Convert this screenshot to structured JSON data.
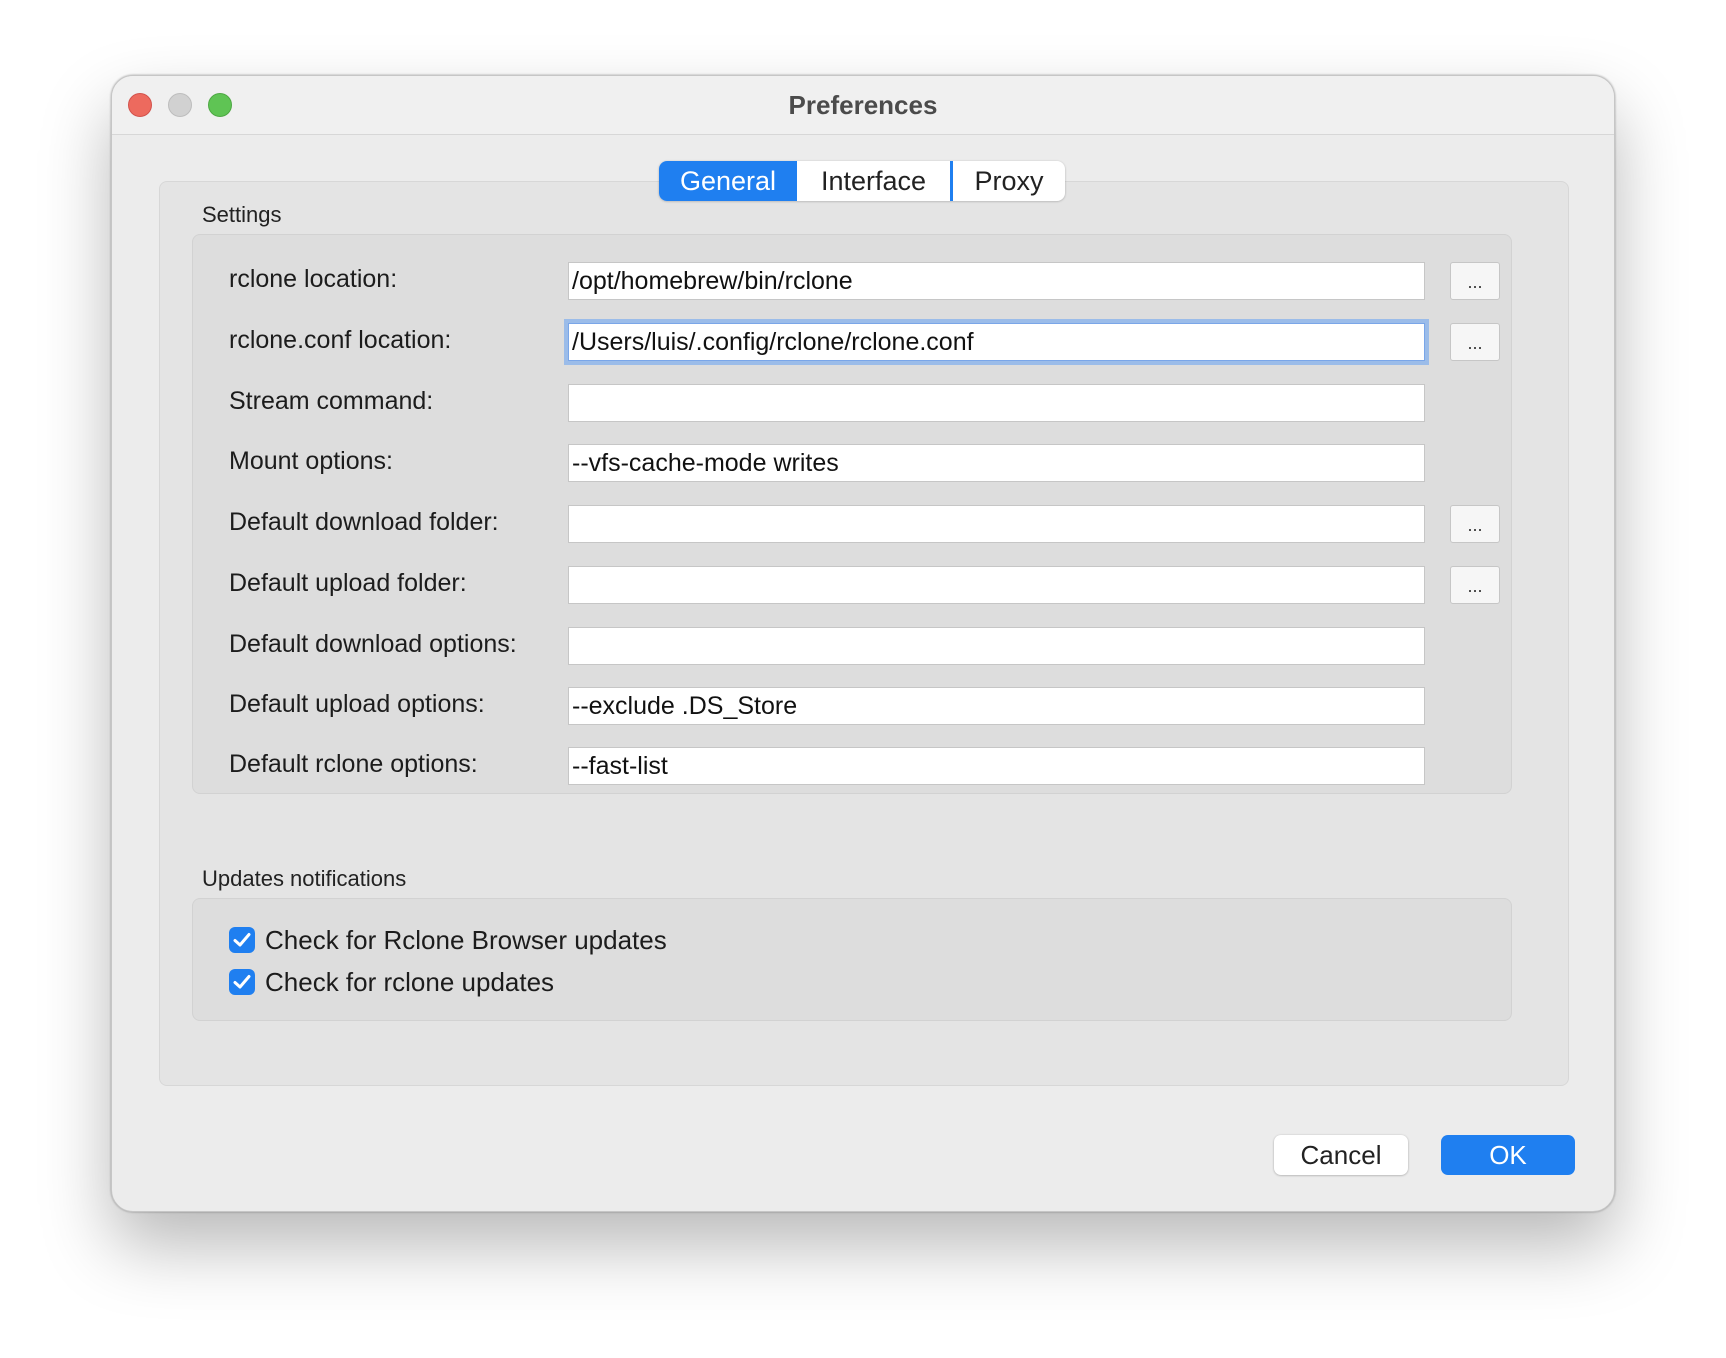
{
  "window": {
    "title": "Preferences"
  },
  "tabs": [
    {
      "label": "General",
      "active": true
    },
    {
      "label": "Interface",
      "active": false
    },
    {
      "label": "Proxy",
      "active": false
    }
  ],
  "settings": {
    "group_label": "Settings",
    "rows": [
      {
        "label": "rclone location:",
        "value": "/opt/homebrew/bin/rclone",
        "has_browse": true
      },
      {
        "label": "rclone.conf location:",
        "value": "/Users/luis/.config/rclone/rclone.conf",
        "has_browse": true,
        "focused": true
      },
      {
        "label": "Stream command:",
        "value": "",
        "has_browse": false
      },
      {
        "label": "Mount options:",
        "value": "--vfs-cache-mode writes",
        "has_browse": false
      },
      {
        "label": "Default download folder:",
        "value": "",
        "has_browse": true
      },
      {
        "label": "Default upload folder:",
        "value": "",
        "has_browse": true
      },
      {
        "label": "Default download options:",
        "value": "",
        "has_browse": false
      },
      {
        "label": "Default upload options:",
        "value": "--exclude .DS_Store",
        "has_browse": false
      },
      {
        "label": "Default rclone options:",
        "value": "--fast-list",
        "has_browse": false
      }
    ],
    "browse_label": "..."
  },
  "updates": {
    "group_label": "Updates notifications",
    "checks": [
      {
        "label": "Check for Rclone Browser updates",
        "checked": true
      },
      {
        "label": "Check for rclone updates",
        "checked": true
      }
    ]
  },
  "buttons": {
    "cancel_label": "Cancel",
    "ok_label": "OK"
  },
  "colors": {
    "accent": "#1f7ff0",
    "close": "#ed6a5e",
    "minimize": "#d1d1d1",
    "maximize": "#5fc454"
  }
}
